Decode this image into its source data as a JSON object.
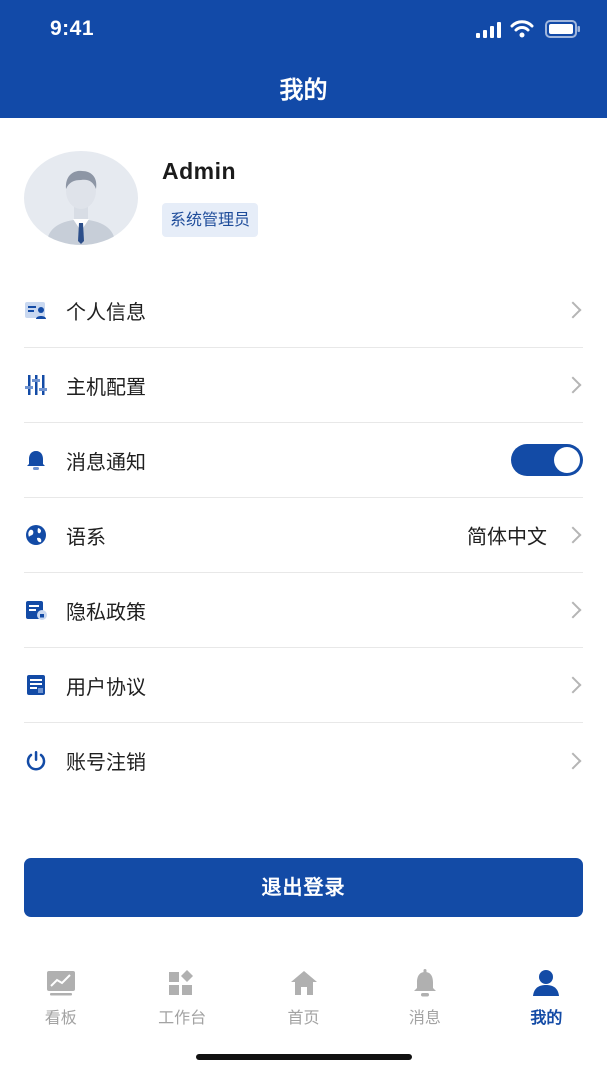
{
  "status_bar": {
    "time": "9:41"
  },
  "header": {
    "title": "我的"
  },
  "profile": {
    "name": "Admin",
    "role": "系统管理员"
  },
  "menu": [
    {
      "label": "个人信息",
      "icon": "id-card-icon",
      "type": "link"
    },
    {
      "label": "主机配置",
      "icon": "sliders-icon",
      "type": "link"
    },
    {
      "label": "消息通知",
      "icon": "bell-icon",
      "type": "toggle",
      "enabled": true
    },
    {
      "label": "语系",
      "icon": "globe-icon",
      "type": "link",
      "value": "简体中文"
    },
    {
      "label": "隐私政策",
      "icon": "privacy-doc-icon",
      "type": "link"
    },
    {
      "label": "用户协议",
      "icon": "agreement-doc-icon",
      "type": "link"
    },
    {
      "label": "账号注销",
      "icon": "power-icon",
      "type": "link"
    }
  ],
  "logout_button": "退出登录",
  "tabbar": [
    {
      "label": "看板",
      "icon": "chart-icon",
      "active": false
    },
    {
      "label": "工作台",
      "icon": "workbench-grid-icon",
      "active": false
    },
    {
      "label": "首页",
      "icon": "home-icon",
      "active": false
    },
    {
      "label": "消息",
      "icon": "bell-icon",
      "active": false
    },
    {
      "label": "我的",
      "icon": "user-icon",
      "active": true
    }
  ],
  "colors": {
    "primary": "#134ba6",
    "header": "#124aa8",
    "inactive": "#a3a3a3",
    "badge_bg": "#e6edf8"
  }
}
